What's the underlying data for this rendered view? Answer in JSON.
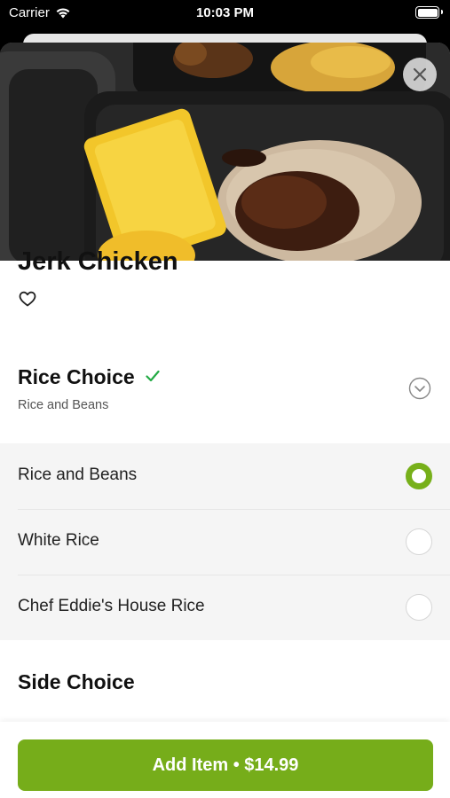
{
  "status_bar": {
    "carrier": "Carrier",
    "time": "10:03 PM"
  },
  "item": {
    "name": "Jerk Chicken"
  },
  "section": {
    "title": "Rice Choice",
    "selected_summary": "Rice and Beans",
    "options": [
      {
        "label": "Rice and Beans",
        "selected": true
      },
      {
        "label": "White Rice",
        "selected": false
      },
      {
        "label": "Chef Eddie's House Rice",
        "selected": false
      }
    ]
  },
  "next_section": {
    "title": "Side Choice"
  },
  "footer": {
    "add_label": "Add Item • $14.99"
  },
  "colors": {
    "accent": "#76ad1a",
    "check": "#22aa44"
  },
  "icons": [
    "wifi-icon",
    "battery-icon",
    "close-icon",
    "heart-icon",
    "checkmark-icon",
    "chevron-down-icon"
  ]
}
